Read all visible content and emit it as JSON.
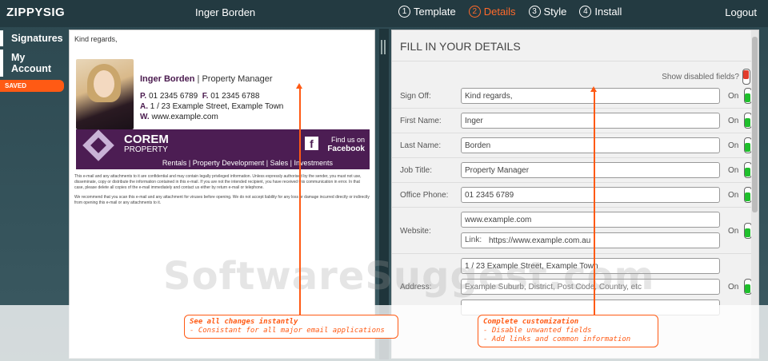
{
  "topbar": {
    "brand": "ZIPPYSIG",
    "user": "Inger Borden",
    "steps": [
      {
        "num": "1",
        "label": "Template"
      },
      {
        "num": "2",
        "label": "Details"
      },
      {
        "num": "3",
        "label": "Style"
      },
      {
        "num": "4",
        "label": "Install"
      }
    ],
    "logout": "Logout"
  },
  "sidebar": {
    "items": [
      {
        "label": "Signatures"
      },
      {
        "label": "My Account"
      }
    ],
    "saved": "SAVED"
  },
  "preview": {
    "signoff": "Kind regards,",
    "name": "Inger Borden",
    "sep": " | ",
    "title": "Property Manager",
    "phone_p": "P.",
    "phone": "01 2345 6789",
    "phone_f": "F.",
    "fax": "01 2345 6788",
    "addr_a": "A.",
    "address": "1 / 23 Example Street, Example Town",
    "web_w": "W.",
    "website": "www.example.com",
    "banner": {
      "corem": "COREM",
      "property": "PROPERTY",
      "findus": "Find us on",
      "facebook": "Facebook",
      "fb": "f",
      "links": "Rentals  |  Property Development  |  Sales  |  Investments"
    },
    "legal1": "This e-mail and any attachments to it are confidential and may contain legally privileged information. Unless expressly authorised by the sender, you must not use, disseminate, copy or distribute the information contained in this e-mail. If you are not the intended recipient, you have received this communication in error. In that case, please delete all copies of the e-mail immediately and contact us either by return e-mail or telephone.",
    "legal2": "We recommend that you scan this e-mail and any attachment for viruses before opening. We do not accept liability for any loss or damage incurred directly or indirectly from opening this e-mail or any attachments to it."
  },
  "form": {
    "heading": "FILL IN YOUR DETAILS",
    "show_disabled": "Show disabled fields?",
    "on": "On",
    "fields": {
      "signoff": {
        "label": "Sign Off:",
        "value": "Kind regards,"
      },
      "first": {
        "label": "First Name:",
        "value": "Inger"
      },
      "last": {
        "label": "Last Name:",
        "value": "Borden"
      },
      "job": {
        "label": "Job Title:",
        "value": "Property Manager"
      },
      "office": {
        "label": "Office Phone:",
        "value": "01 2345 6789"
      },
      "website": {
        "label": "Website:",
        "value": "www.example.com",
        "link_label": "Link:",
        "link": "https://www.example.com.au"
      },
      "address": {
        "label": "Address:",
        "value": "1 / 23 Example Street, Example Town",
        "placeholder2": "Example Suburb, District, Post Code, Country, etc"
      }
    }
  },
  "watermark": "SoftwareSuggest.com",
  "callouts": {
    "left": {
      "line1": "See all changes instantly",
      "line2": " - Consistant for all major email applications"
    },
    "right": {
      "line1": "Complete customization",
      "line2": " - Disable unwanted fields",
      "line3": " - Add links and common information"
    }
  },
  "colors": {
    "accent": "#ff5a14",
    "brand_purple": "#4c1d53",
    "toggle_on": "#1fbf2c",
    "toggle_off": "#e23b2b"
  }
}
